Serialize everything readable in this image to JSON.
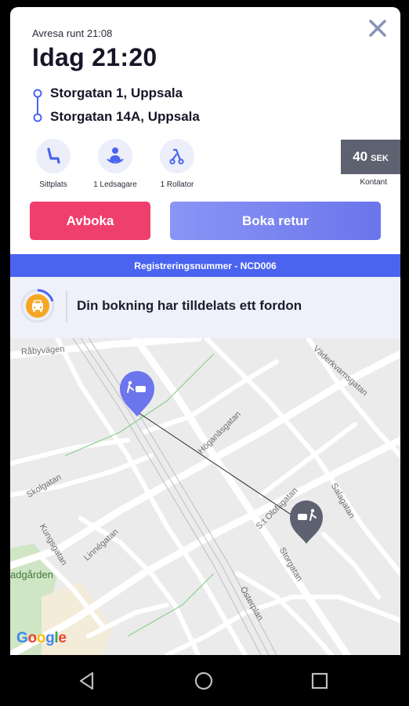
{
  "header": {
    "departure_note": "Avresa runt 21:08",
    "time_title": "Idag 21:20"
  },
  "route": {
    "from": "Storgatan 1, Uppsala",
    "to": "Storgatan 14A, Uppsala"
  },
  "services": [
    {
      "icon": "seat-icon",
      "label": "Sittplats"
    },
    {
      "icon": "companion-icon",
      "label": "1 Ledsagare"
    },
    {
      "icon": "rollator-icon",
      "label": "1 Rollator"
    }
  ],
  "price": {
    "amount": "40",
    "currency": "SEK",
    "payment": "Kontant"
  },
  "actions": {
    "cancel_label": "Avboka",
    "return_label": "Boka retur"
  },
  "registration": "Registreringsnummer - NCD006",
  "status": {
    "message": "Din bokning har tilldelats ett fordon"
  },
  "map": {
    "street_labels": [
      "Råbyvägen",
      "Väderkvarnsgatan",
      "Höganäsgatan",
      "Skolgatan",
      "Kungsgatan",
      "Linnégatan",
      "S:t Olofsgatan",
      "Salagatan",
      "Storgatan",
      "Österplan",
      "adgården"
    ],
    "attribution": [
      "G",
      "o",
      "o",
      "g",
      "l",
      "e"
    ]
  },
  "colors": {
    "accent": "#4a64f0",
    "cancel": "#ef3f6d",
    "return_start": "#8a95f5",
    "return_end": "#6b75ec",
    "status_icon": "#f5a623",
    "price_bg": "#5d6170"
  }
}
